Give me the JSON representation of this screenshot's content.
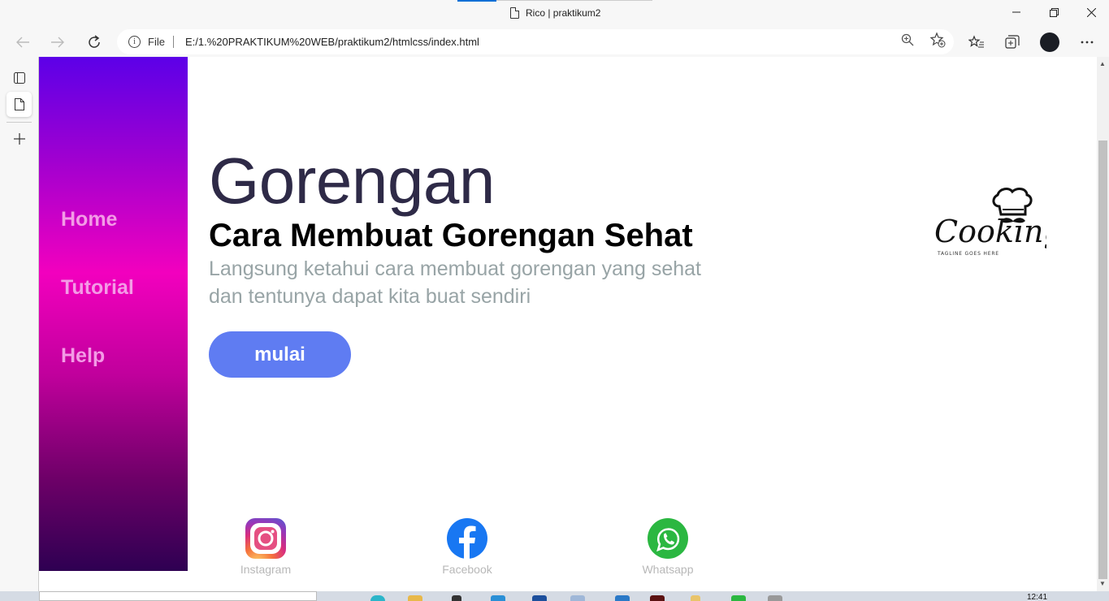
{
  "browser": {
    "tab_title": "Rico | praktikum2",
    "address_prefix": "File",
    "url": "E:/1.%20PRAKTIKUM%20WEB/praktikum2/htmlcss/index.html",
    "icons": [
      "back-icon",
      "forward-icon",
      "refresh-icon",
      "info-icon",
      "zoom-icon",
      "add-favorite-icon",
      "favorites-icon",
      "collections-icon",
      "profile-icon",
      "more-icon"
    ]
  },
  "page": {
    "nav": [
      {
        "label": "Home"
      },
      {
        "label": "Tutorial"
      },
      {
        "label": "Help"
      }
    ],
    "hero": {
      "title": "Gorengan",
      "subtitle": "Cara Membuat Gorengan Sehat",
      "description": "Langsung ketahui cara membuat gorengan yang sehat dan tentunya dapat kita buat sendiri",
      "button": "mulai"
    },
    "logo": {
      "text": "Cooking",
      "tagline": "TAGLINE GOES HERE"
    },
    "social": [
      {
        "label": "Instagram",
        "icon": "instagram-icon"
      },
      {
        "label": "Facebook",
        "icon": "facebook-icon"
      },
      {
        "label": "Whatsapp",
        "icon": "whatsapp-icon"
      }
    ],
    "colors": {
      "nav_gradient_top": "#5c00e8",
      "nav_gradient_mid": "#f200be",
      "nav_gradient_bottom": "#2e0052",
      "nav_link": "#f39be6",
      "button": "#5f7cf2",
      "title": "#2e2a47",
      "description": "#98a4a6"
    }
  },
  "taskbar": {
    "clock": "12:41"
  }
}
